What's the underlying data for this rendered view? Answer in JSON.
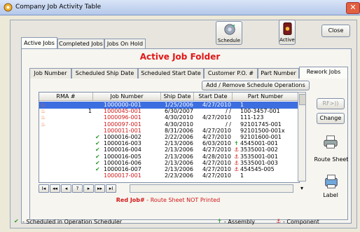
{
  "window": {
    "title": "Company Job Activity Table",
    "close_glyph": "✕"
  },
  "toolbar": {
    "schedule_label": "Schedule",
    "active_label": "Active",
    "close_label": "Close"
  },
  "tabs": [
    "Active Jobs",
    "Completed Jobs",
    "Jobs On Hold"
  ],
  "folder_title": "Active Job Folder",
  "sort_tabs": [
    "Job Number",
    "Scheduled Ship Date",
    "Scheduled Start Date",
    "Customer P.O. #",
    "Part Number",
    "Rework Jobs"
  ],
  "add_remove_label": "Add / Remove Schedule Operations",
  "side_buttons": {
    "rfx_label": "RF>))",
    "change_label": "Change",
    "route_sheet_label": "Route Sheet",
    "label_label": "Label"
  },
  "columns": [
    "RMA #",
    "Job Number",
    "Ship Date",
    "Start Date",
    "Part Number"
  ],
  "rows": [
    {
      "flag": "flame",
      "rma": "",
      "job": "1000000-001",
      "ship": "1/25/2006",
      "start": "4/27/2010",
      "part": "1",
      "red": true,
      "selected": true,
      "mark": ""
    },
    {
      "flag": "flame",
      "rma": "1",
      "job": "1000045-001",
      "ship": "6/30/2007",
      "start": "/ /",
      "part": "100-3457-001",
      "red": true,
      "selected": false,
      "mark": ""
    },
    {
      "flag": "flame",
      "rma": "",
      "job": "1000096-001",
      "ship": "4/30/2010",
      "start": "4/27/2010",
      "part": "111-123",
      "red": true,
      "selected": false,
      "mark": ""
    },
    {
      "flag": "flame",
      "rma": "",
      "job": "1000097-001",
      "ship": "4/30/2010",
      "start": "/ /",
      "part": "92101745-001",
      "red": true,
      "selected": false,
      "mark": ""
    },
    {
      "flag": "",
      "rma": "",
      "job": "1000011-001",
      "ship": "8/31/2006",
      "start": "4/27/2010",
      "part": "92101500-001x",
      "red": true,
      "selected": false,
      "mark": ""
    },
    {
      "flag": "check",
      "rma": "",
      "job": "1000016-002",
      "ship": "2/22/2006",
      "start": "4/27/2010",
      "part": "92101600-001",
      "red": false,
      "selected": false,
      "mark": ""
    },
    {
      "flag": "check",
      "rma": "",
      "job": "1000016-003",
      "ship": "2/13/2006",
      "start": "6/03/2010",
      "part": "4545001-001",
      "red": false,
      "selected": false,
      "mark": "assembly"
    },
    {
      "flag": "check",
      "rma": "",
      "job": "1000016-004",
      "ship": "2/13/2006",
      "start": "4/27/2010",
      "part": "3535001-002",
      "red": false,
      "selected": false,
      "mark": "component"
    },
    {
      "flag": "check",
      "rma": "",
      "job": "1000016-005",
      "ship": "2/13/2006",
      "start": "4/28/2010",
      "part": "3535001-001",
      "red": false,
      "selected": false,
      "mark": "component"
    },
    {
      "flag": "check",
      "rma": "",
      "job": "1000016-006",
      "ship": "2/13/2006",
      "start": "4/27/2010",
      "part": "3535001-003",
      "red": false,
      "selected": false,
      "mark": "component"
    },
    {
      "flag": "check",
      "rma": "",
      "job": "1000016-007",
      "ship": "2/13/2006",
      "start": "4/27/2010",
      "part": "454545-005",
      "red": false,
      "selected": false,
      "mark": "component"
    },
    {
      "flag": "",
      "rma": "",
      "job": "1000017-001",
      "ship": "2/23/2006",
      "start": "4/27/2010",
      "part": "1",
      "red": true,
      "selected": false,
      "mark": ""
    }
  ],
  "nav_buttons": [
    "I◂",
    "◂◂",
    "◂",
    "?",
    "▸",
    "▸▸",
    "▸I"
  ],
  "status": {
    "red_label": "Red Job#",
    "rest": " - Route Sheet NOT Printed"
  },
  "legend": {
    "scheduled": " - Scheduled in Operation Scheduler",
    "assembly": " - Assembly",
    "component": " - Component"
  },
  "colors": {
    "red": "#d01818",
    "check": "#2e9a2e",
    "flame": "#e8601c",
    "selection": "#3d6ee0"
  }
}
